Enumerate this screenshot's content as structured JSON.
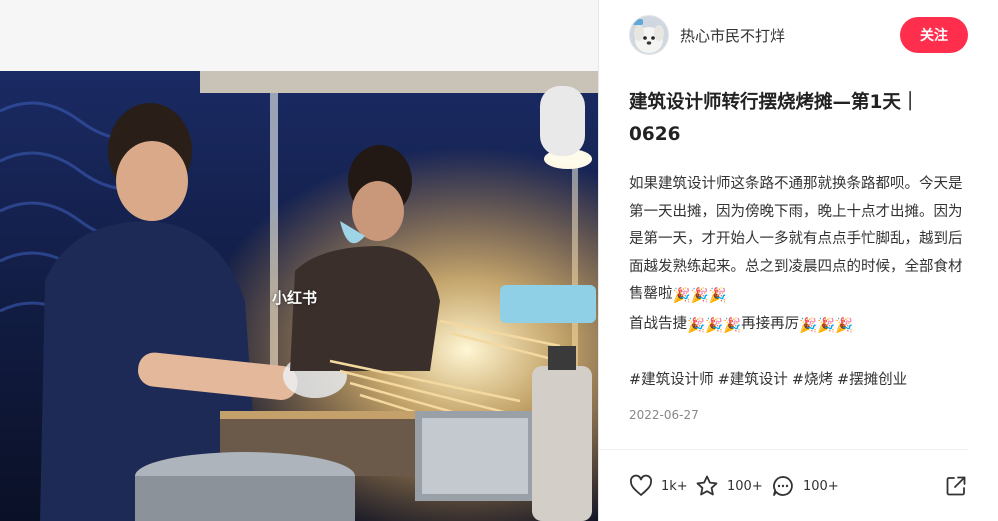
{
  "media": {
    "watermark": "小红书"
  },
  "author": {
    "name": "热心市民不打烊",
    "follow_label": "关注"
  },
  "note": {
    "title": "建筑设计师转行摆烧烤摊—第1天｜0626",
    "body_lines": [
      "如果建筑设计师这条路不通那就换条路都呗。今天是第一天出摊，因为傍晚下雨，晚上十点才出摊。因为是第一天，才开始人一多就有点点手忙脚乱，越到后面越发熟练起来。总之到凌晨四点的时候，全部食材售罄啦",
      "首战告捷",
      "再接再厉"
    ],
    "hashtags": [
      "#建筑设计师",
      "#建筑设计",
      "#烧烤",
      "#摆摊创业"
    ],
    "date": "2022-06-27"
  },
  "actions": {
    "likes": "1k+",
    "collects": "100+",
    "comments": "100+"
  },
  "colors": {
    "accent": "#ff2e4d",
    "text": "#333333",
    "muted": "#888888"
  },
  "icons": [
    "heart-icon",
    "star-icon",
    "comment-icon",
    "share-icon",
    "party-popper-emoji"
  ]
}
